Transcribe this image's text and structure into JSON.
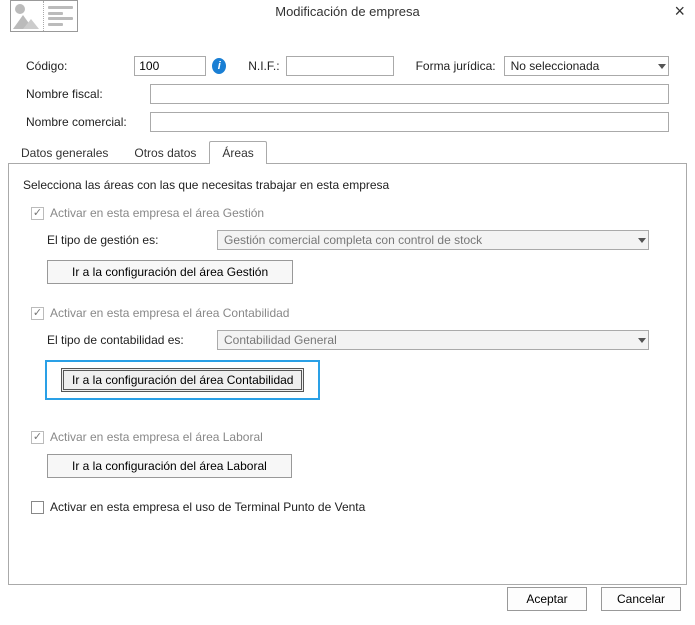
{
  "dialog": {
    "title": "Modificación de empresa"
  },
  "form": {
    "codigo_label": "Código:",
    "codigo_value": "100",
    "nif_label": "N.I.F.:",
    "nif_value": "",
    "forma_label": "Forma jurídica:",
    "forma_selected": "No seleccionada",
    "nombre_fiscal_label": "Nombre fiscal:",
    "nombre_fiscal_value": "",
    "nombre_comercial_label": "Nombre comercial:",
    "nombre_comercial_value": ""
  },
  "tabs": {
    "t0": "Datos generales",
    "t1": "Otros datos",
    "t2": "Áreas"
  },
  "areas": {
    "instruction": "Selecciona las áreas con las que necesitas trabajar en esta empresa",
    "gestion": {
      "activate": "Activar en esta empresa el área Gestión",
      "tipo_label": "El tipo de gestión es:",
      "tipo_value": "Gestión comercial completa con control de stock",
      "goto": "Ir a la configuración del área Gestión"
    },
    "contabilidad": {
      "activate": "Activar en esta empresa el área Contabilidad",
      "tipo_label": "El tipo de contabilidad es:",
      "tipo_value": "Contabilidad General",
      "goto": "Ir a la configuración del área Contabilidad"
    },
    "laboral": {
      "activate": "Activar en esta empresa el área Laboral",
      "goto": "Ir a la configuración del área Laboral"
    },
    "tpv": {
      "activate": "Activar en esta empresa el uso de Terminal Punto de Venta"
    }
  },
  "buttons": {
    "accept": "Aceptar",
    "cancel": "Cancelar"
  }
}
